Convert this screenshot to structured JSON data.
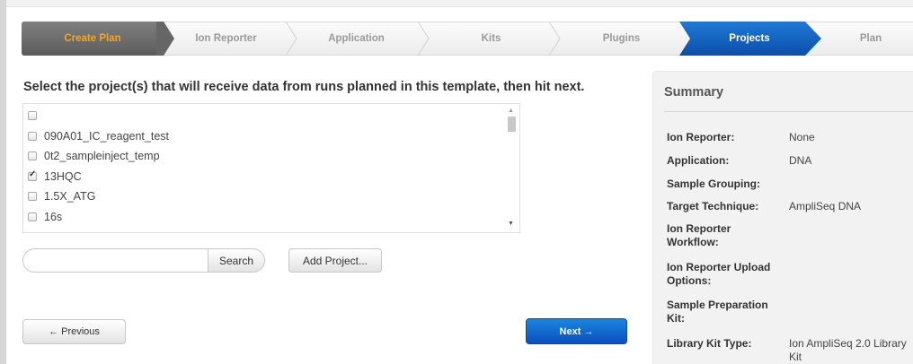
{
  "wizard": {
    "steps": [
      {
        "label": "Create Plan"
      },
      {
        "label": "Ion Reporter"
      },
      {
        "label": "Application"
      },
      {
        "label": "Kits"
      },
      {
        "label": "Plugins"
      },
      {
        "label": "Projects"
      },
      {
        "label": "Plan"
      }
    ],
    "active_step": "Projects",
    "colors": {
      "first_bg": "#6b6b6b",
      "first_text": "#f5a623",
      "active_bg": "#1565c0",
      "active_text": "#ffffff"
    }
  },
  "main": {
    "heading": "Select the project(s) that will receive data from runs planned in this template, then hit next.",
    "projects": [
      {
        "label": "",
        "checked": false
      },
      {
        "label": "090A01_IC_reagent_test",
        "checked": false
      },
      {
        "label": "0t2_sampleinject_temp",
        "checked": false
      },
      {
        "label": "13HQC",
        "checked": true
      },
      {
        "label": "1.5X_ATG",
        "checked": false
      },
      {
        "label": "16s",
        "checked": false
      }
    ],
    "search": {
      "value": "",
      "placeholder": "",
      "button_label": "Search"
    },
    "add_project_label": "Add Project...",
    "previous_label": "← Previous",
    "next_label": "Next →"
  },
  "summary": {
    "title": "Summary",
    "rows": [
      {
        "label": "Ion Reporter:",
        "value": "None"
      },
      {
        "label": "Application:",
        "value": "DNA"
      },
      {
        "label": "Sample Grouping:",
        "value": ""
      },
      {
        "label": "Target Technique:",
        "value": "AmpliSeq DNA"
      },
      {
        "label": "Ion Reporter Workflow:",
        "value": ""
      },
      {
        "label": "Ion Reporter Upload Options:",
        "value": ""
      },
      {
        "label": "Sample Preparation Kit:",
        "value": ""
      },
      {
        "label": "Library Kit Type:",
        "value": "Ion AmpliSeq 2.0 Library Kit"
      }
    ]
  }
}
